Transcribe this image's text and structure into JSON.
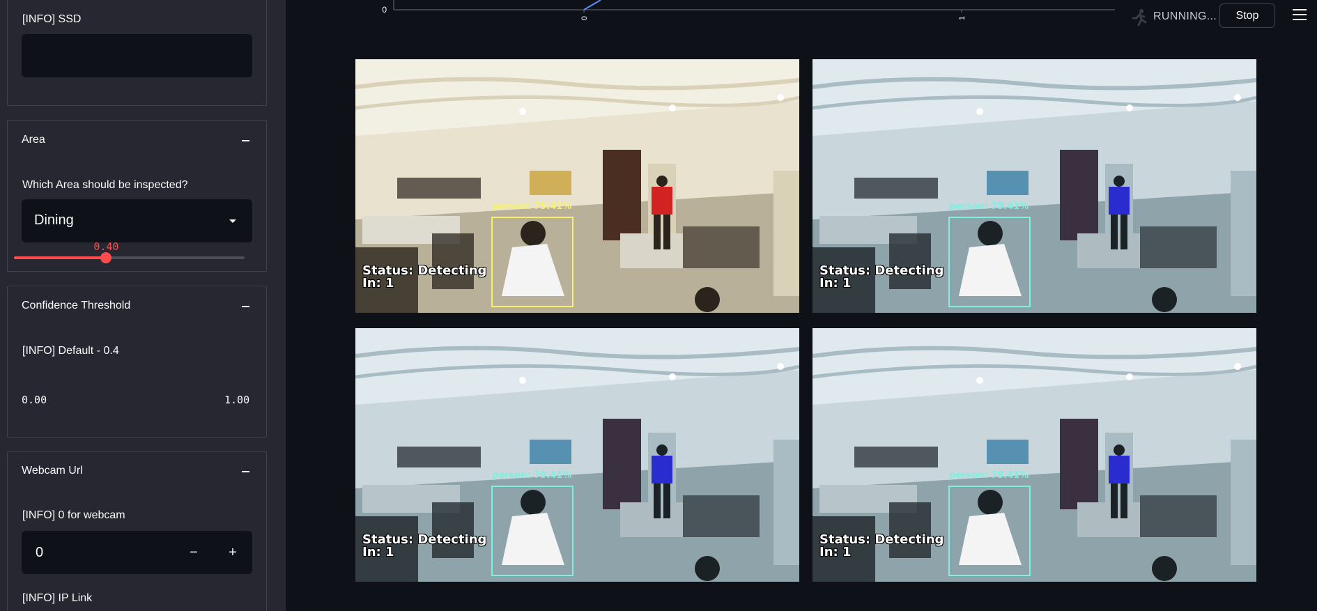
{
  "sidebar": {
    "ssd": {
      "label": "[INFO] SSD",
      "value": ""
    },
    "area": {
      "title": "Area",
      "question": "Which Area should be inspected?",
      "selected": "Dining"
    },
    "confidence": {
      "title": "Confidence Threshold",
      "info": "[INFO] Default - 0.4",
      "value": 0.4,
      "value_label": "0.40",
      "min_label": "0.00",
      "max_label": "1.00",
      "accent": "#ff4b4b"
    },
    "webcam": {
      "title": "Webcam Url",
      "info": "[INFO] 0 for webcam",
      "value": "0",
      "minus": "−",
      "plus": "+",
      "ip_label": "[INFO] IP Link"
    }
  },
  "header": {
    "status": "RUNNING...",
    "stop_label": "Stop",
    "chart": {
      "y_tick": "0",
      "x_ticks": [
        "0",
        "1"
      ]
    }
  },
  "feeds": [
    {
      "status": "Status: Detecting",
      "count": "In: 1",
      "detection": "person: 79.41%",
      "box_color": "#f7f26a",
      "tint": "warm"
    },
    {
      "status": "Status: Detecting",
      "count": "In: 1",
      "detection": "person: 79.41%",
      "box_color": "#7ff0e0",
      "tint": "cool"
    },
    {
      "status": "Status: Detecting",
      "count": "In: 1",
      "detection": "person: 79.41%",
      "box_color": "#7ff0e0",
      "tint": "cool"
    },
    {
      "status": "Status: Detecting",
      "count": "In: 1",
      "detection": "person: 79.41%",
      "box_color": "#7ff0e0",
      "tint": "cool"
    }
  ]
}
